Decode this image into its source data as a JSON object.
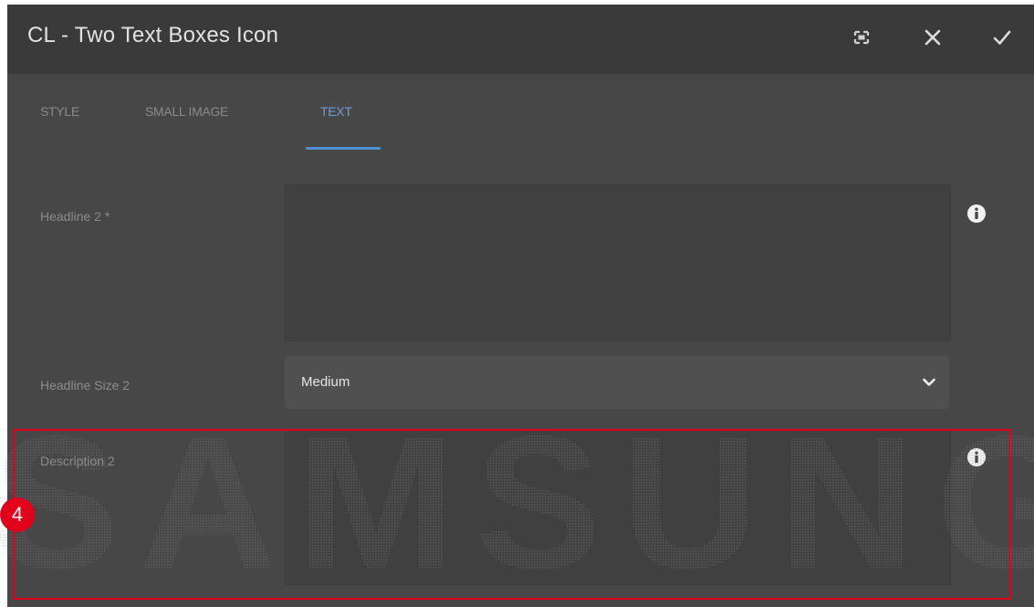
{
  "dialog": {
    "title": "CL - Two Text Boxes Icon",
    "buttons": {
      "fullscreen_icon": "fullscreen-icon",
      "close_icon": "close-icon",
      "confirm_icon": "checkmark-icon"
    }
  },
  "tabs": [
    {
      "label": "STYLE",
      "active": false
    },
    {
      "label": "SMALL IMAGE",
      "active": false
    },
    {
      "label": "TEXT",
      "active": true
    }
  ],
  "form": {
    "headline2": {
      "label": "Headline 2 *",
      "value": "",
      "info_icon": "info-icon"
    },
    "headline_size2": {
      "label": "Headline Size 2",
      "value": "Medium",
      "chevron_icon": "chevron-down-icon"
    },
    "description2": {
      "label": "Description 2",
      "value": "",
      "info_icon": "info-icon"
    }
  },
  "annotation": {
    "marker": "4",
    "color": "#e2001a"
  },
  "watermark": {
    "text": "SAMSUNG"
  },
  "colors": {
    "accent": "#4e8fd6",
    "dialog_bg": "#474747",
    "header_bg": "#3a3a3a"
  }
}
